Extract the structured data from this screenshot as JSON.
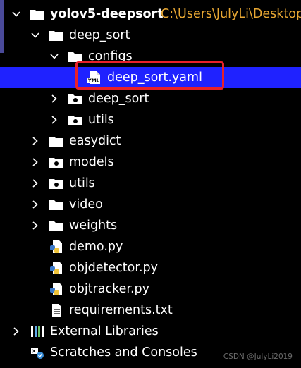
{
  "tree": {
    "root": {
      "name": "yolov5-deepsort",
      "path": "C:\\Users\\JulyLi\\Desktop"
    },
    "deep_sort_folder": {
      "name": "deep_sort"
    },
    "configs_folder": {
      "name": "configs"
    },
    "config_file": {
      "name": "deep_sort.yaml",
      "icon_badge": "YML"
    },
    "deep_sort_subpackage": {
      "name": "deep_sort"
    },
    "utils_subpackage": {
      "name": "utils"
    },
    "easydict_folder": {
      "name": "easydict"
    },
    "models_package": {
      "name": "models"
    },
    "utils_package": {
      "name": "utils"
    },
    "video_folder": {
      "name": "video"
    },
    "weights_folder": {
      "name": "weights"
    },
    "files": [
      {
        "name": "demo.py"
      },
      {
        "name": "objdetector.py"
      },
      {
        "name": "objtracker.py"
      },
      {
        "name": "requirements.txt"
      }
    ],
    "external_libraries": {
      "name": "External Libraries"
    },
    "scratches_consoles": {
      "name": "Scratches and Consoles"
    }
  },
  "watermark": "CSDN @JulyLi2019",
  "colors": {
    "background": "#000000",
    "selection": "#1f22ff",
    "highlight_border": "#e8202a",
    "path_text": "#e8a733",
    "text": "#ffffff"
  },
  "icons": {
    "folder": "folder-icon",
    "package": "package-folder-icon",
    "python": "python-file-icon",
    "text": "text-file-icon",
    "yaml": "yaml-file-icon",
    "libraries": "libraries-icon",
    "scratches": "scratches-icon",
    "expanded": "chevron-down-icon",
    "collapsed": "chevron-right-icon"
  }
}
